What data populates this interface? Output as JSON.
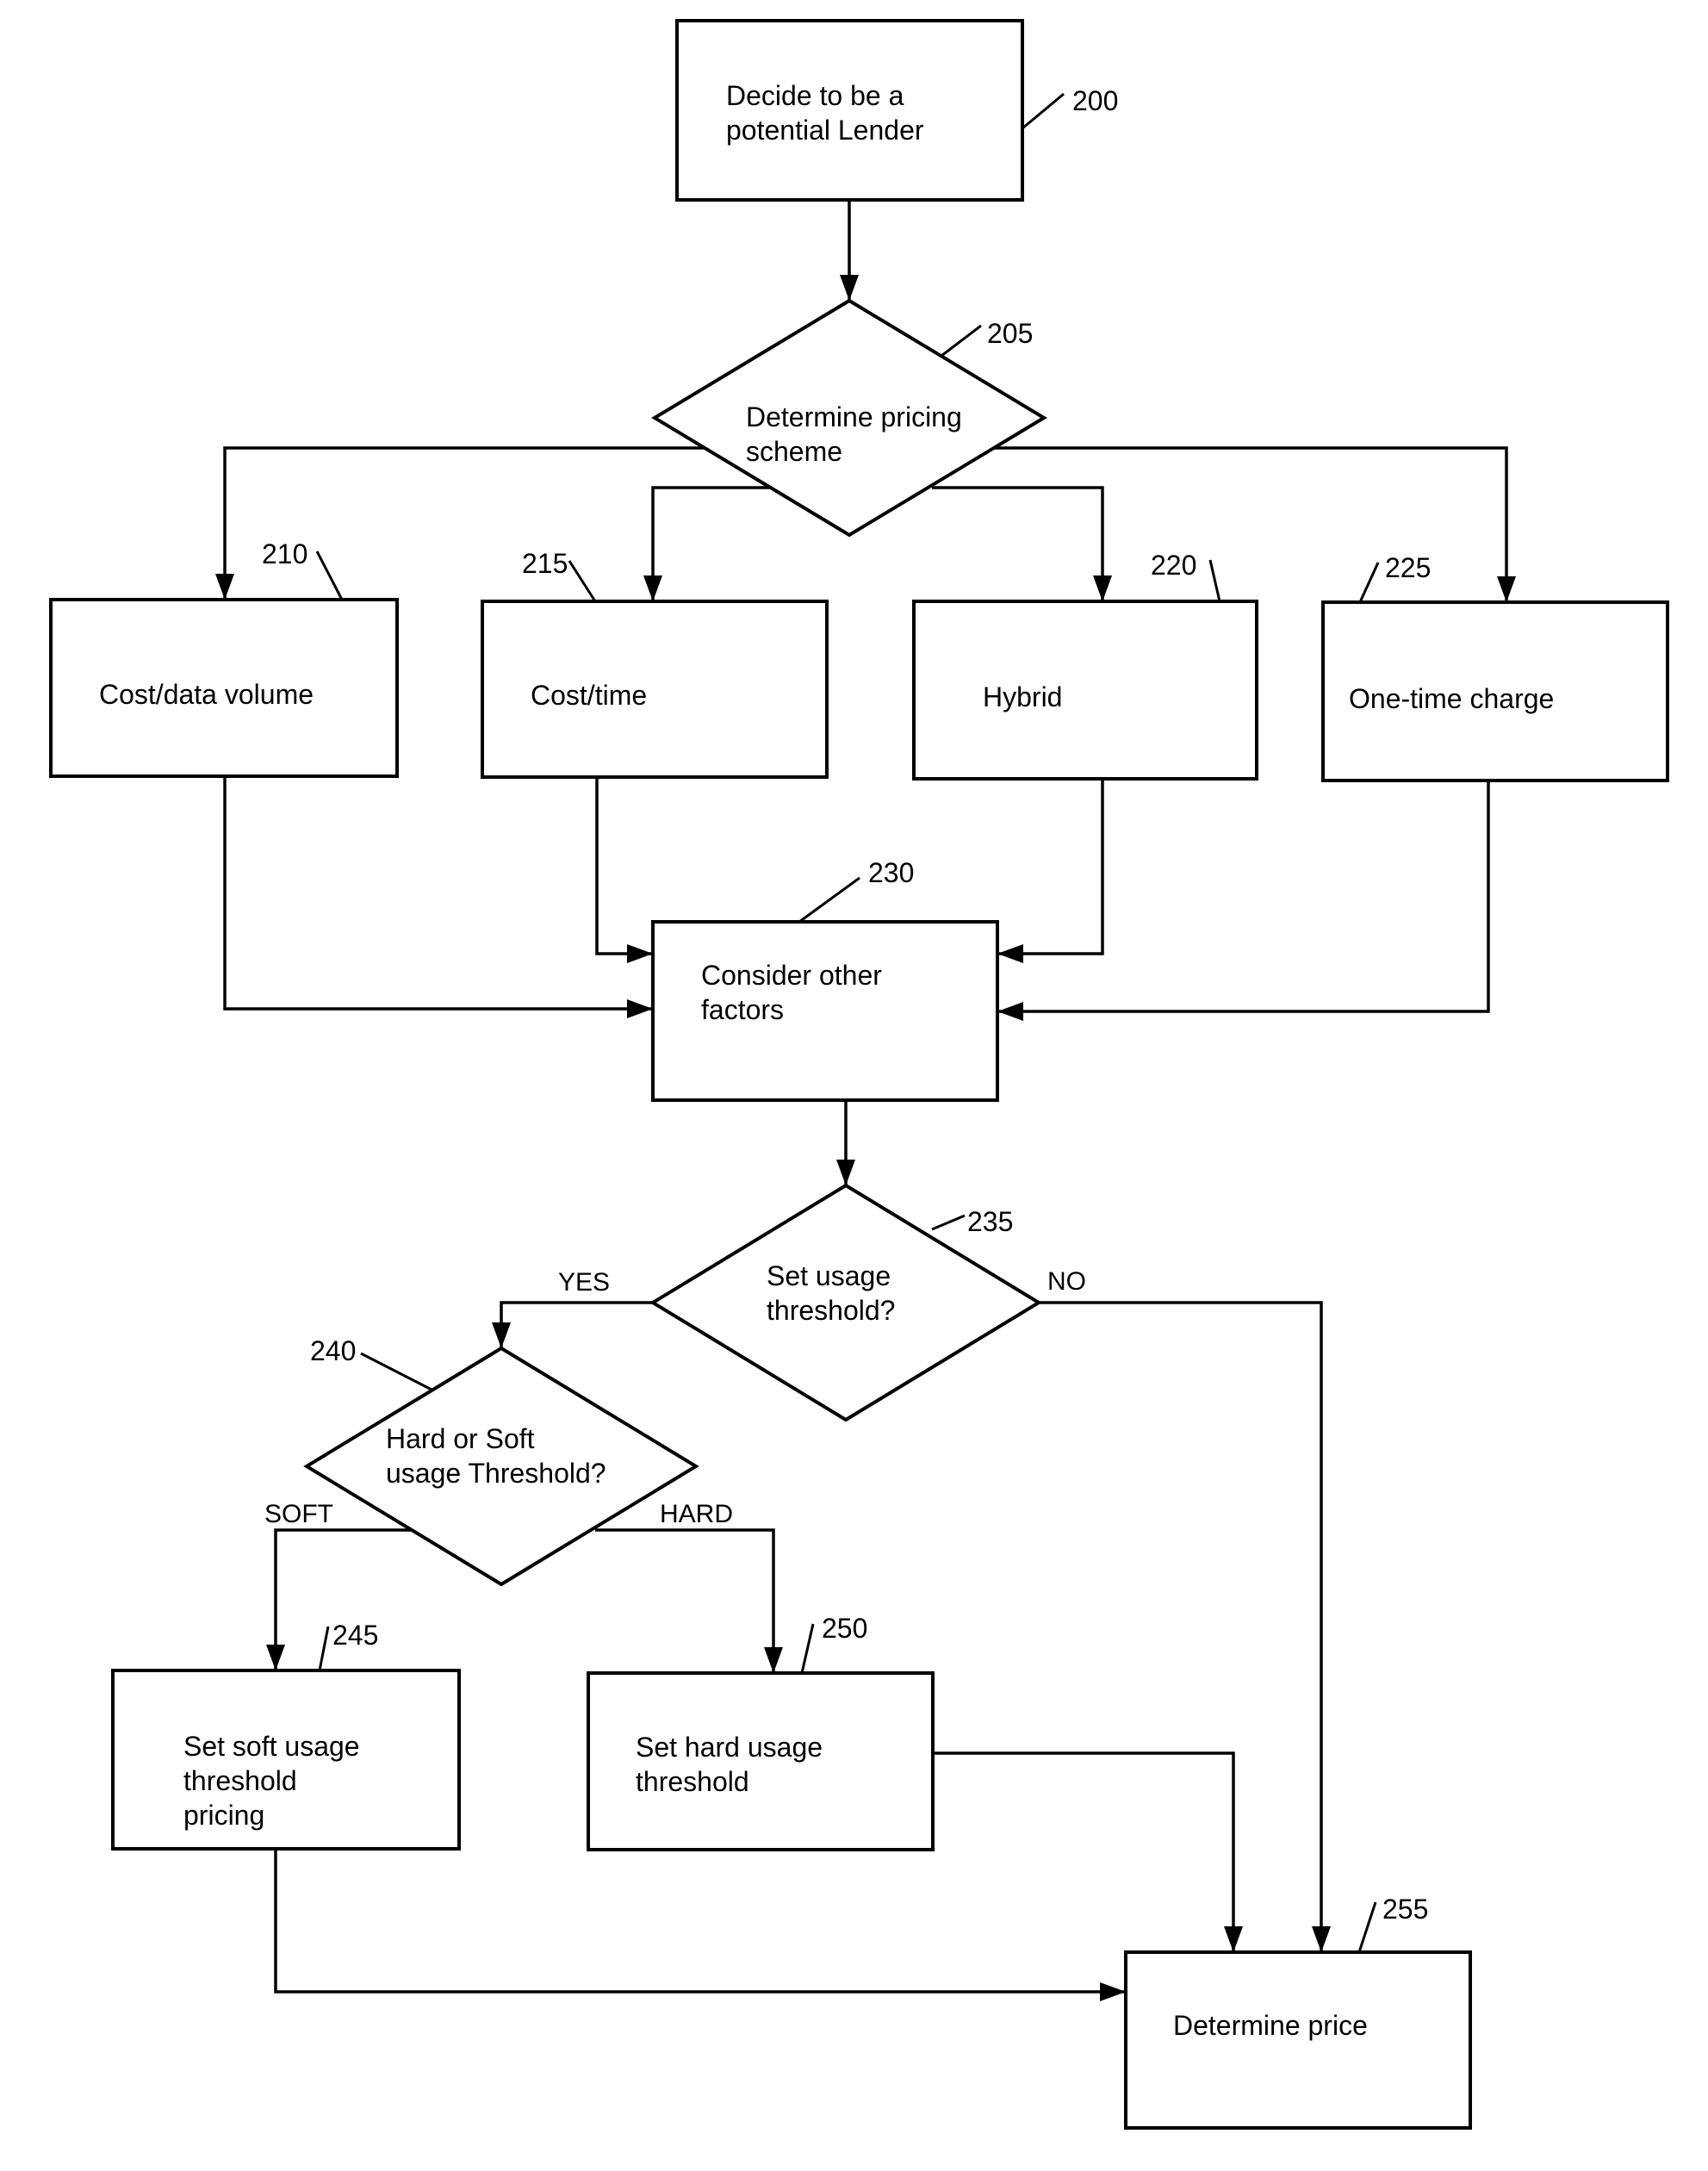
{
  "diagram": {
    "type": "flowchart",
    "colors": {
      "stroke": "#000000",
      "background": "#ffffff"
    },
    "nodes": [
      {
        "id": "200",
        "shape": "process",
        "ref": "200",
        "lines": [
          "Decide to be a",
          "potential Lender"
        ]
      },
      {
        "id": "205",
        "shape": "decision",
        "ref": "205",
        "lines": [
          "Determine pricing",
          "scheme"
        ]
      },
      {
        "id": "210",
        "shape": "process",
        "ref": "210",
        "lines": [
          "Cost/data volume"
        ]
      },
      {
        "id": "215",
        "shape": "process",
        "ref": "215",
        "lines": [
          "Cost/time"
        ]
      },
      {
        "id": "220",
        "shape": "process",
        "ref": "220",
        "lines": [
          "Hybrid"
        ]
      },
      {
        "id": "225",
        "shape": "process",
        "ref": "225",
        "lines": [
          "One-time charge"
        ]
      },
      {
        "id": "230",
        "shape": "process",
        "ref": "230",
        "lines": [
          "Consider other",
          "factors"
        ]
      },
      {
        "id": "235",
        "shape": "decision",
        "ref": "235",
        "lines": [
          "Set usage",
          "threshold?"
        ]
      },
      {
        "id": "240",
        "shape": "decision",
        "ref": "240",
        "lines": [
          "Hard or Soft",
          "usage Threshold?"
        ]
      },
      {
        "id": "245",
        "shape": "process",
        "ref": "245",
        "lines": [
          "Set soft usage",
          "threshold",
          "pricing"
        ]
      },
      {
        "id": "250",
        "shape": "process",
        "ref": "250",
        "lines": [
          "Set hard usage",
          "threshold"
        ]
      },
      {
        "id": "255",
        "shape": "process",
        "ref": "255",
        "lines": [
          "Determine price"
        ]
      }
    ],
    "edges": [
      {
        "from": "200",
        "to": "205",
        "label": ""
      },
      {
        "from": "205",
        "to": "210",
        "label": ""
      },
      {
        "from": "205",
        "to": "215",
        "label": ""
      },
      {
        "from": "205",
        "to": "220",
        "label": ""
      },
      {
        "from": "205",
        "to": "225",
        "label": ""
      },
      {
        "from": "210",
        "to": "230",
        "label": ""
      },
      {
        "from": "215",
        "to": "230",
        "label": ""
      },
      {
        "from": "220",
        "to": "230",
        "label": ""
      },
      {
        "from": "225",
        "to": "230",
        "label": ""
      },
      {
        "from": "230",
        "to": "235",
        "label": ""
      },
      {
        "from": "235",
        "to": "240",
        "label": "YES"
      },
      {
        "from": "235",
        "to": "255",
        "label": "NO"
      },
      {
        "from": "240",
        "to": "245",
        "label": "SOFT"
      },
      {
        "from": "240",
        "to": "250",
        "label": "HARD"
      },
      {
        "from": "245",
        "to": "255",
        "label": ""
      },
      {
        "from": "250",
        "to": "255",
        "label": ""
      }
    ]
  }
}
